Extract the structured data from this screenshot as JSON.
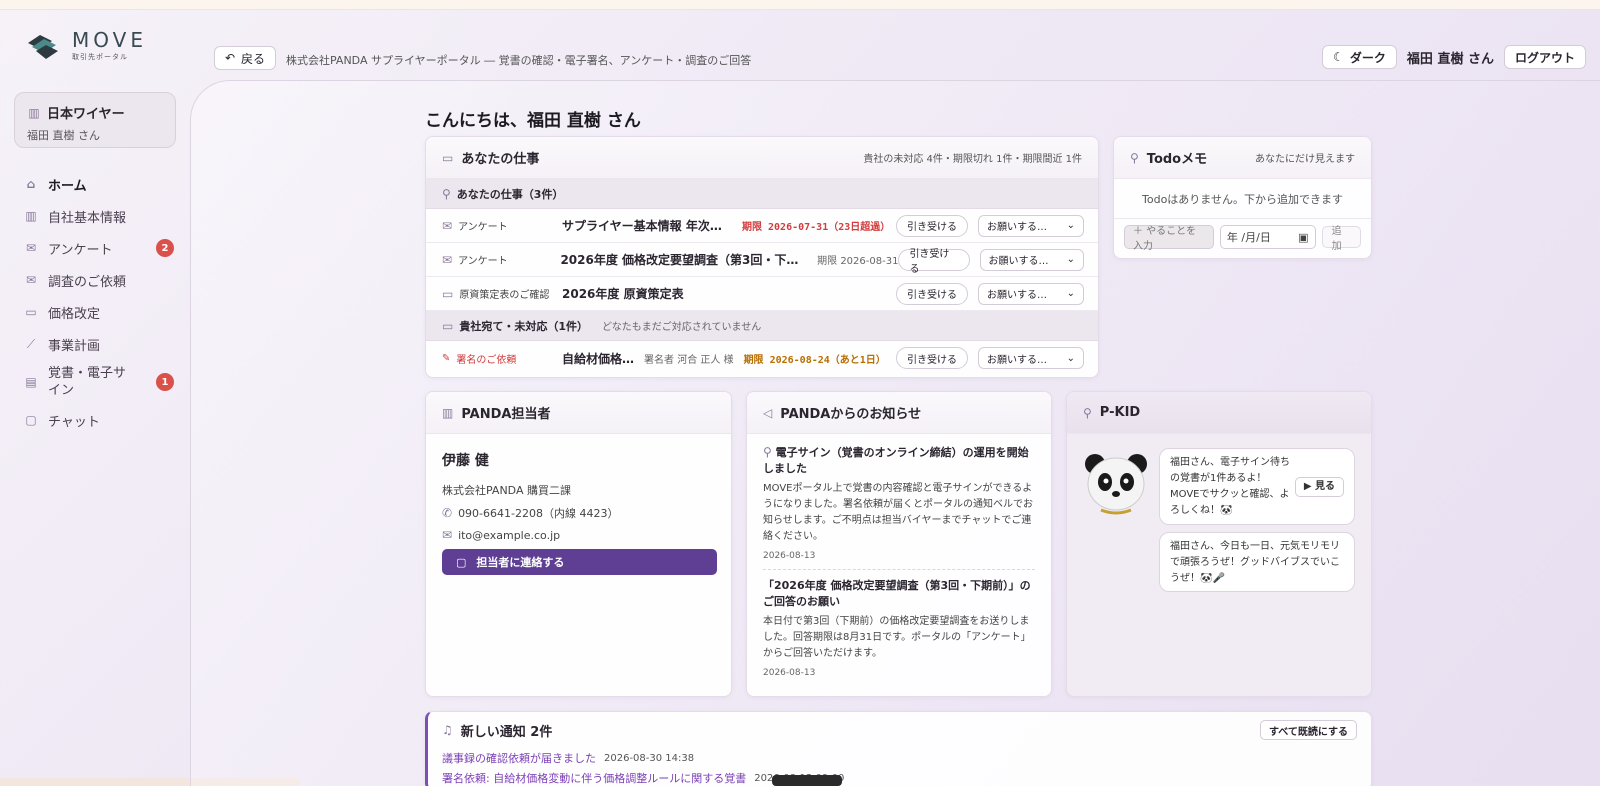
{
  "app": {
    "logo_title": "MOVE",
    "logo_sub": "取引先ポータル"
  },
  "header": {
    "back_label": "戻る",
    "breadcrumb": "株式会社PANDA サプライヤーポータル ― 覚書の確認・電子署名、アンケート・調査のご回答",
    "theme_label": "ダーク",
    "user_name": "福田 直樹 さん",
    "logout_label": "ログアウト"
  },
  "sidebar": {
    "company": "日本ワイヤー",
    "user": "福田 直樹 さん",
    "items": [
      {
        "label": "ホーム",
        "icon": "home-icon",
        "active": true
      },
      {
        "label": "自社基本情報",
        "icon": "building-icon"
      },
      {
        "label": "アンケート",
        "icon": "mail-icon",
        "badge": "2"
      },
      {
        "label": "調査のご依頼",
        "icon": "mail-icon"
      },
      {
        "label": "価格改定",
        "icon": "folder-icon"
      },
      {
        "label": "事業計画",
        "icon": "chart-icon"
      },
      {
        "label": "覚書・電子サイン",
        "icon": "document-icon",
        "badge": "1"
      },
      {
        "label": "チャット",
        "icon": "chat-icon"
      }
    ]
  },
  "greeting": "こんにちは、福田 直樹 さん",
  "work": {
    "title": "あなたの仕事",
    "summary": "貴社の未対応 4件・期限切れ 1件・期限間近 1件",
    "group1": "あなたの仕事（3件）",
    "rows": [
      {
        "type": "アンケート",
        "title": "サプライヤー基本情報 年次更新…",
        "meta": "期限 2026-07-31（23日超過）",
        "take": "引き受ける",
        "select": "お願いする…"
      },
      {
        "type": "アンケート",
        "title": "2026年度 価格改定要望調査（第3回・下期…",
        "meta": "期限 2026-08-31",
        "take": "引き受ける",
        "select": "お願いする…"
      },
      {
        "type": "原資策定表のご確認",
        "title": "2026年度 原資策定表",
        "meta": "",
        "take": "引き受ける",
        "select": "お願いする…"
      }
    ],
    "group2": "貴社宛て・未対応（1件）",
    "group2_note": "どなたもまだご対応されていません",
    "row4": {
      "type": "署名のご依頼",
      "title": "自給材価格…",
      "signer": "署名者 河合 正人 様",
      "meta": "期限 2026-08-24（あと1日）",
      "take": "引き受ける",
      "select": "お願いする…"
    }
  },
  "todo": {
    "title": "Todoメモ",
    "note": "あなたにだけ見えます",
    "empty": "Todoはありません。下から追加できます",
    "input_placeholder": "＋ やることを入力",
    "date_placeholder": "年 /月/日",
    "add_label": "追加"
  },
  "contact": {
    "title": "PANDA担当者",
    "name": "伊藤 健",
    "dept": "株式会社PANDA 購買二課",
    "phone": "090-6641-2208（内線 4423）",
    "email": "ito@example.co.jp",
    "button": "担当者に連絡する"
  },
  "news": {
    "title": "PANDAからのお知らせ",
    "items": [
      {
        "title": "電子サイン（覚書のオンライン締結）の運用を開始しました",
        "text": "MOVEポータル上で覚書の内容確認と電子サインができるようになりました。署名依頼が届くとポータルの通知ベルでお知らせします。ご不明点は担当バイヤーまでチャットでご連絡ください。",
        "date": "2026-08-13"
      },
      {
        "title": "「2026年度 価格改定要望調査（第3回・下期前）」のご回答のお願い",
        "text": "本日付で第3回（下期前）の価格改定要望調査をお送りしました。回答期限は8月31日です。ポータルの「アンケート」からご回答いただけます。",
        "date": "2026-08-13"
      }
    ]
  },
  "pkid": {
    "title": "P-KID",
    "bubble1": "福田さん、電子サイン待ちの覚書が1件あるよ！MOVEでサクッと確認、よろしくね！🐼",
    "see_label": "▶ 見る",
    "bubble2": "福田さん、今日も一日、元気モリモリで頑張ろうぜ！グッドバイブスでいこうぜ！🐼🎤"
  },
  "notifications": {
    "title": "新しい通知 2件",
    "mark_all": "すべて既読にする",
    "items": [
      {
        "text": "議事録の確認依頼が届きました",
        "time": "2026-08-30 14:38"
      },
      {
        "text": "署名依頼: 自給材価格変動に伴う価格調整ルールに関する覚書",
        "time": "2026-08-12 09:00"
      }
    ]
  }
}
